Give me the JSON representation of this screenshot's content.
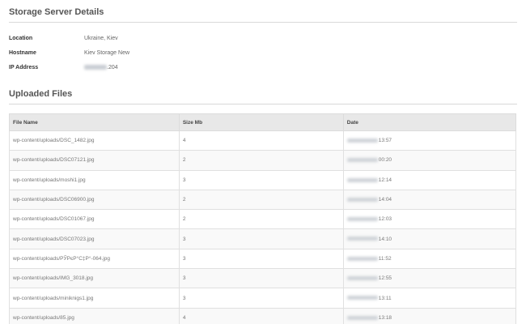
{
  "server": {
    "title": "Storage Server Details",
    "location_label": "Location",
    "location_value": "Ukraine, Kiev",
    "hostname_label": "Hostname",
    "hostname_value": "Kiev Storage New",
    "ip_label": "IP Address",
    "ip_suffix": ".204"
  },
  "files": {
    "title": "Uploaded Files",
    "columns": {
      "name": "File Name",
      "size": "Size Mb",
      "date": "Date"
    },
    "rows": [
      {
        "name": "wp-content/uploads/DSC_1482.jpg",
        "size": "4",
        "time": "13:57"
      },
      {
        "name": "wp-content/uploads/DSC07121.jpg",
        "size": "2",
        "time": "00:20"
      },
      {
        "name": "wp-content/uploads/moshi1.jpg",
        "size": "3",
        "time": "12:14"
      },
      {
        "name": "wp-content/uploads/DSC06900.jpg",
        "size": "2",
        "time": "14:04"
      },
      {
        "name": "wp-content/uploads/DSC01067.jpg",
        "size": "2",
        "time": "12:03"
      },
      {
        "name": "wp-content/uploads/DSC07023.jpg",
        "size": "3",
        "time": "14:10"
      },
      {
        "name": "wp-content/uploads/РЎРєР°С‡Р°-064.jpg",
        "size": "3",
        "time": "11:52"
      },
      {
        "name": "wp-content/uploads/IMG_3018.jpg",
        "size": "3",
        "time": "12:55"
      },
      {
        "name": "wp-content/uploads/miniknigs1.jpg",
        "size": "3",
        "time": "13:11"
      },
      {
        "name": "wp-content/uploads/85.jpg",
        "size": "4",
        "time": "13:18"
      }
    ]
  }
}
